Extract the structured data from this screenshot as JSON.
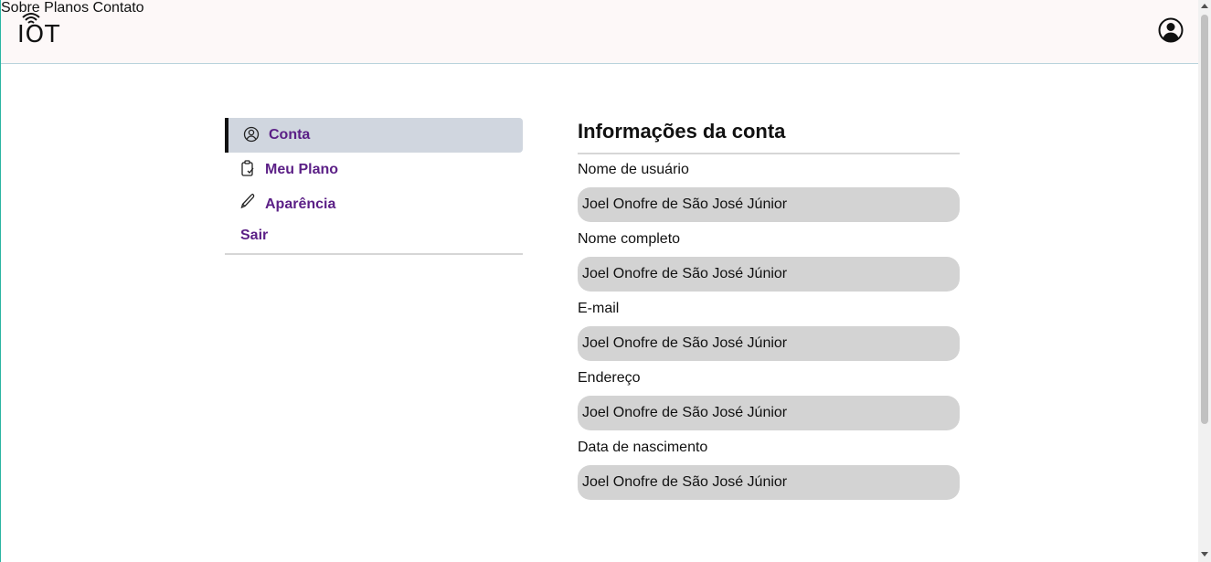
{
  "header": {
    "logo_text": "IOT",
    "nav": [
      {
        "label": "Sobre"
      },
      {
        "label": "Planos"
      },
      {
        "label": "Contato"
      }
    ]
  },
  "sidebar": {
    "items": [
      {
        "label": "Conta",
        "icon": "user-circle-icon",
        "active": true
      },
      {
        "label": "Meu Plano",
        "icon": "clipboard-icon",
        "active": false
      },
      {
        "label": "Aparência",
        "icon": "pencil-icon",
        "active": false
      },
      {
        "label": "Sair",
        "active": false
      }
    ]
  },
  "account": {
    "title": "Informações da conta",
    "fields": [
      {
        "label": "Nome de usuário",
        "value": "Joel Onofre de São José Júnior"
      },
      {
        "label": "Nome completo",
        "value": "Joel Onofre de São José Júnior"
      },
      {
        "label": "E-mail",
        "value": "Joel Onofre de São José Júnior"
      },
      {
        "label": "Endereço",
        "value": "Joel Onofre de São José Júnior"
      },
      {
        "label": "Data de nascimento",
        "value": "Joel Onofre de São José Júnior"
      }
    ]
  },
  "colors": {
    "accent_purple": "#5b1f86",
    "active_bg": "#d0d6df",
    "field_bg": "#d3d3d3",
    "header_bg": "#fdf8f8"
  }
}
